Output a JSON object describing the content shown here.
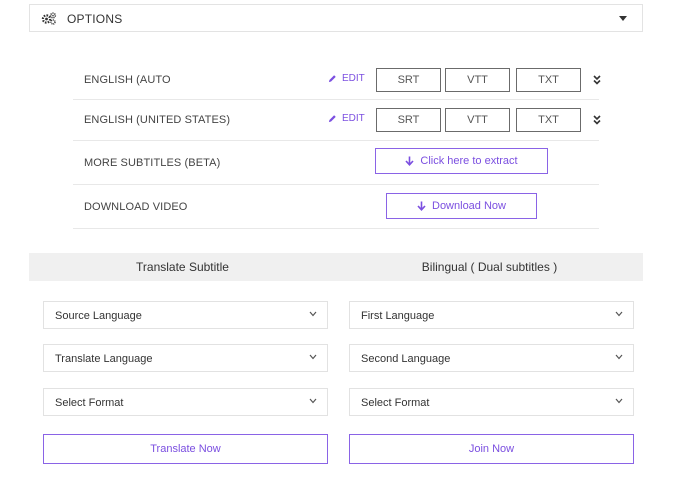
{
  "options": {
    "label": "OPTIONS",
    "icon": "gears-icon"
  },
  "subtitle_rows": [
    {
      "label": "ENGLISH (AUTO",
      "edit_label": "EDIT",
      "formats": [
        "SRT",
        "VTT",
        "TXT"
      ]
    },
    {
      "label": "ENGLISH (UNITED STATES)",
      "edit_label": "EDIT",
      "formats": [
        "SRT",
        "VTT",
        "TXT"
      ]
    }
  ],
  "more_subtitles": {
    "label": "MORE SUBTITLES (BETA)",
    "button_label": "Click here to extract"
  },
  "download_video": {
    "label": "DOWNLOAD VIDEO",
    "button_label": "Download Now"
  },
  "tabs": {
    "translate": "Translate Subtitle",
    "bilingual": "Bilingual ( Dual subtitles )"
  },
  "translate_panel": {
    "source_language": "Source Language",
    "translate_language": "Translate Language",
    "format": "Select Format",
    "button_label": "Translate Now"
  },
  "bilingual_panel": {
    "first_language": "First Language",
    "second_language": "Second Language",
    "format": "Select Format",
    "button_label": "Join Now"
  },
  "colors": {
    "accent": "#7b4fe0",
    "accent_border": "#8a63e6",
    "tab_bg": "#f0f0f0"
  }
}
